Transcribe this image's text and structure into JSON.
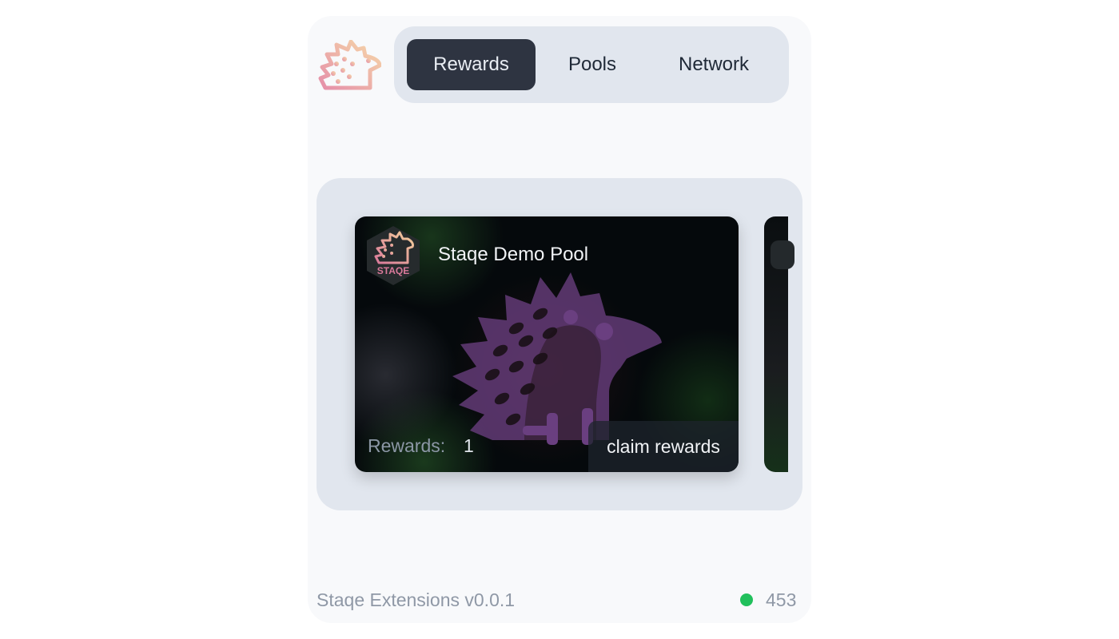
{
  "app": {
    "logo_icon": "hedgehog-logo-icon"
  },
  "nav": {
    "tabs": [
      {
        "label": "Rewards",
        "active": true
      },
      {
        "label": "Pools",
        "active": false
      },
      {
        "label": "Network",
        "active": false
      }
    ]
  },
  "carousel": {
    "cards": [
      {
        "pool_name": "Staqe Demo Pool",
        "pool_icon": "staqe-hexagon-icon",
        "pool_icon_text": "STAQE",
        "rewards_label": "Rewards:",
        "rewards_value": "1",
        "claim_label": "claim rewards"
      }
    ]
  },
  "footer": {
    "version": "Staqe Extensions v0.0.1",
    "status": "connected",
    "block_number": "453"
  },
  "colors": {
    "accent_dark": "#2e3441",
    "nav_bg": "#e1e6ee",
    "status_green": "#21c05c",
    "watermark_purple": "#6a3f80"
  }
}
